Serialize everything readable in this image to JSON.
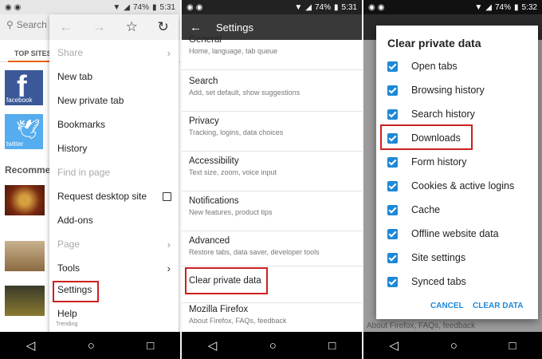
{
  "panel1": {
    "status": {
      "battery": "74%",
      "time": "5:31"
    },
    "search_text": "Search",
    "top_sites_tab": "TOP SITES",
    "tiles": [
      {
        "label": "facebook"
      },
      {
        "label": "twitter"
      }
    ],
    "recommended_label": "Recomme",
    "menu": {
      "items": [
        {
          "label": "Share",
          "disabled": true
        },
        {
          "label": "New tab"
        },
        {
          "label": "New private tab"
        },
        {
          "label": "Bookmarks"
        },
        {
          "label": "History"
        },
        {
          "label": "Find in page",
          "disabled": true
        },
        {
          "label": "Request desktop site"
        },
        {
          "label": "Add-ons"
        },
        {
          "label": "Page",
          "disabled": true
        },
        {
          "label": "Tools"
        },
        {
          "label": "Settings"
        },
        {
          "label": "Help"
        }
      ],
      "trending": "Trending"
    }
  },
  "panel2": {
    "status": {
      "battery": "74%",
      "time": "5:31"
    },
    "toolbar_title": "Settings",
    "items": [
      {
        "title": "General",
        "subtitle": "Home, language, tab queue"
      },
      {
        "title": "Search",
        "subtitle": "Add, set default, show suggestions"
      },
      {
        "title": "Privacy",
        "subtitle": "Tracking, logins, data choices"
      },
      {
        "title": "Accessibility",
        "subtitle": "Text size, zoom, voice input"
      },
      {
        "title": "Notifications",
        "subtitle": "New features, product tips"
      },
      {
        "title": "Advanced",
        "subtitle": "Restore tabs, data saver, developer tools"
      },
      {
        "title": "Clear private data",
        "subtitle": ""
      },
      {
        "title": "Mozilla Firefox",
        "subtitle": "About Firefox, FAQs, feedback"
      }
    ]
  },
  "panel3": {
    "status": {
      "battery": "74%",
      "time": "5:32"
    },
    "background_text": "About Firefox, FAQs, feedback",
    "dialog": {
      "title": "Clear private data",
      "options": [
        {
          "label": "Open tabs",
          "checked": true
        },
        {
          "label": "Browsing history",
          "checked": true
        },
        {
          "label": "Search history",
          "checked": true
        },
        {
          "label": "Downloads",
          "checked": true
        },
        {
          "label": "Form history",
          "checked": true
        },
        {
          "label": "Cookies & active logins",
          "checked": true
        },
        {
          "label": "Cache",
          "checked": true
        },
        {
          "label": "Offline website data",
          "checked": true
        },
        {
          "label": "Site settings",
          "checked": true
        },
        {
          "label": "Synced tabs",
          "checked": true
        }
      ],
      "cancel_label": "CANCEL",
      "clear_label": "CLEAR DATA"
    }
  },
  "colors": {
    "accent_blue": "#1e88d6",
    "highlight_red": "#cc2020",
    "firefox_orange": "#e66000"
  }
}
